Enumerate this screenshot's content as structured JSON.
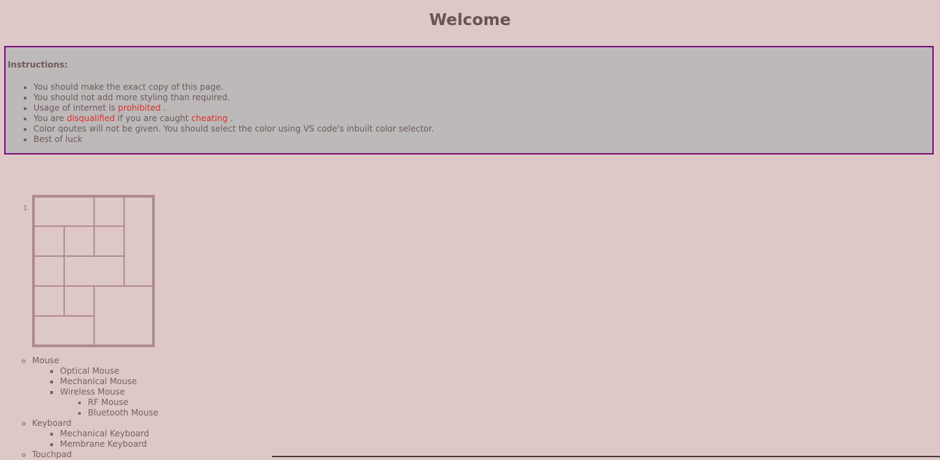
{
  "page": {
    "title": "Welcome"
  },
  "instructions": {
    "heading": "Instructions:",
    "items": [
      {
        "text": "You should make the exact copy of this page."
      },
      {
        "text": "You should not add more styling than required."
      },
      {
        "pre": "Usage of internet is ",
        "red1": "prohibited",
        "post": " ."
      },
      {
        "pre": "You are ",
        "red1": "disqualified",
        "mid": " if you are caught ",
        "red2": "cheating",
        "post": " ."
      },
      {
        "text": "Color qoutes will not be given. You should select the color using VS code's inbuilt color selector."
      },
      {
        "text": "Best of luck"
      }
    ]
  },
  "ordered_list": {
    "marker": "1."
  },
  "devices": {
    "mouse": "Mouse",
    "mouse_types": [
      "Optical Mouse",
      "Mechanical Mouse",
      "Wireless Mouse"
    ],
    "wireless_types": [
      "RF Mouse",
      "Bluetooth Mouse"
    ],
    "keyboard": "Keyboard",
    "keyboard_types": [
      "Mechanical Keyboard",
      "Membrane Keyboard"
    ],
    "touchpad": "Touchpad"
  },
  "colors": {
    "background": "#dec7c7",
    "panel": "#bdb9b9",
    "panel_border": "#7a0f7a",
    "highlight": "#e02d2d",
    "table_border": "#b08c8d"
  }
}
